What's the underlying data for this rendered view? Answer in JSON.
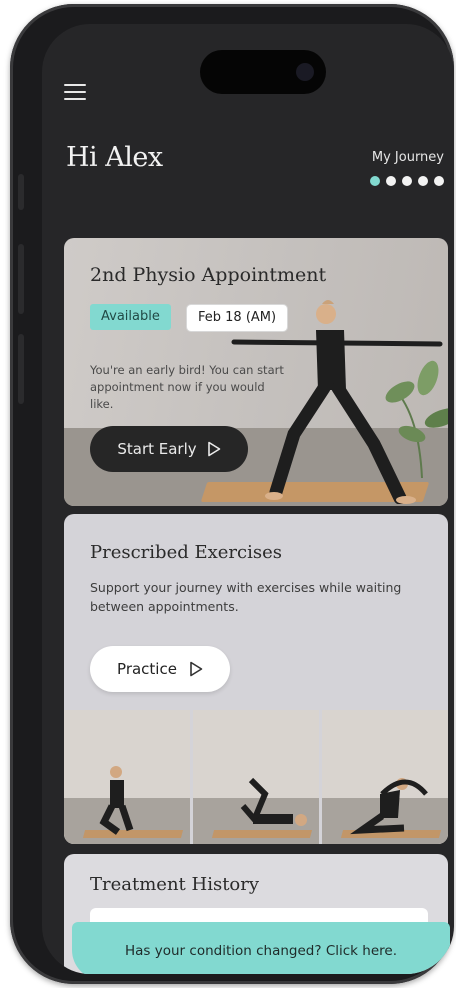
{
  "header": {
    "greeting": "Hi Alex",
    "journey_label": "My Journey",
    "journey_steps": 5,
    "journey_current": 1
  },
  "appointment": {
    "title": "2nd Physio Appointment",
    "status_badge": "Available",
    "date_badge": "Feb 18 (AM)",
    "description": "You're an early bird! You can start appointment now if you would like.",
    "button_label": "Start Early"
  },
  "exercises": {
    "title": "Prescribed Exercises",
    "description": "Support your journey with exercises while waiting between appointments.",
    "button_label": "Practice"
  },
  "history": {
    "title": "Treatment History"
  },
  "banner": {
    "text": "Has your condition changed? Click here."
  },
  "colors": {
    "accent": "#82d9d0",
    "screen_bg": "#262628",
    "card_bg": "#d4d3d8",
    "dark_button": "#262626"
  }
}
